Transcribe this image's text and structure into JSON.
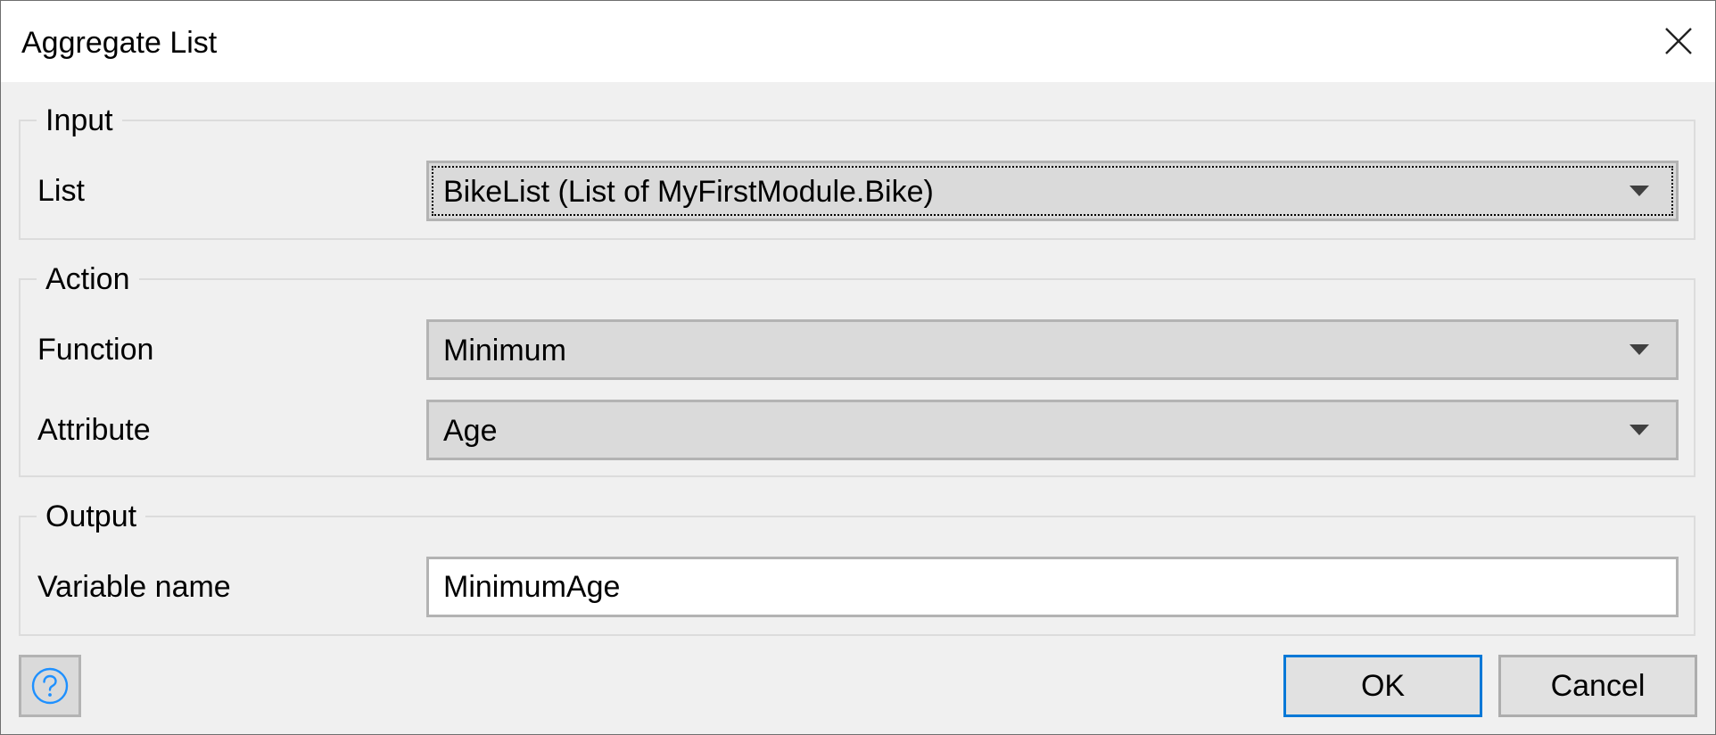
{
  "dialog": {
    "title": "Aggregate List",
    "close_icon": "close-icon"
  },
  "input_group": {
    "legend": "Input",
    "list_label": "List",
    "list_value": "BikeList (List of MyFirstModule.Bike)"
  },
  "action_group": {
    "legend": "Action",
    "function_label": "Function",
    "function_value": "Minimum",
    "attribute_label": "Attribute",
    "attribute_value": "Age"
  },
  "output_group": {
    "legend": "Output",
    "variable_label": "Variable name",
    "variable_value": "MinimumAge"
  },
  "footer": {
    "help_icon": "question-circle-icon",
    "ok_label": "OK",
    "cancel_label": "Cancel"
  },
  "colors": {
    "accent": "#0078d7",
    "help_icon": "#1e90ff"
  }
}
